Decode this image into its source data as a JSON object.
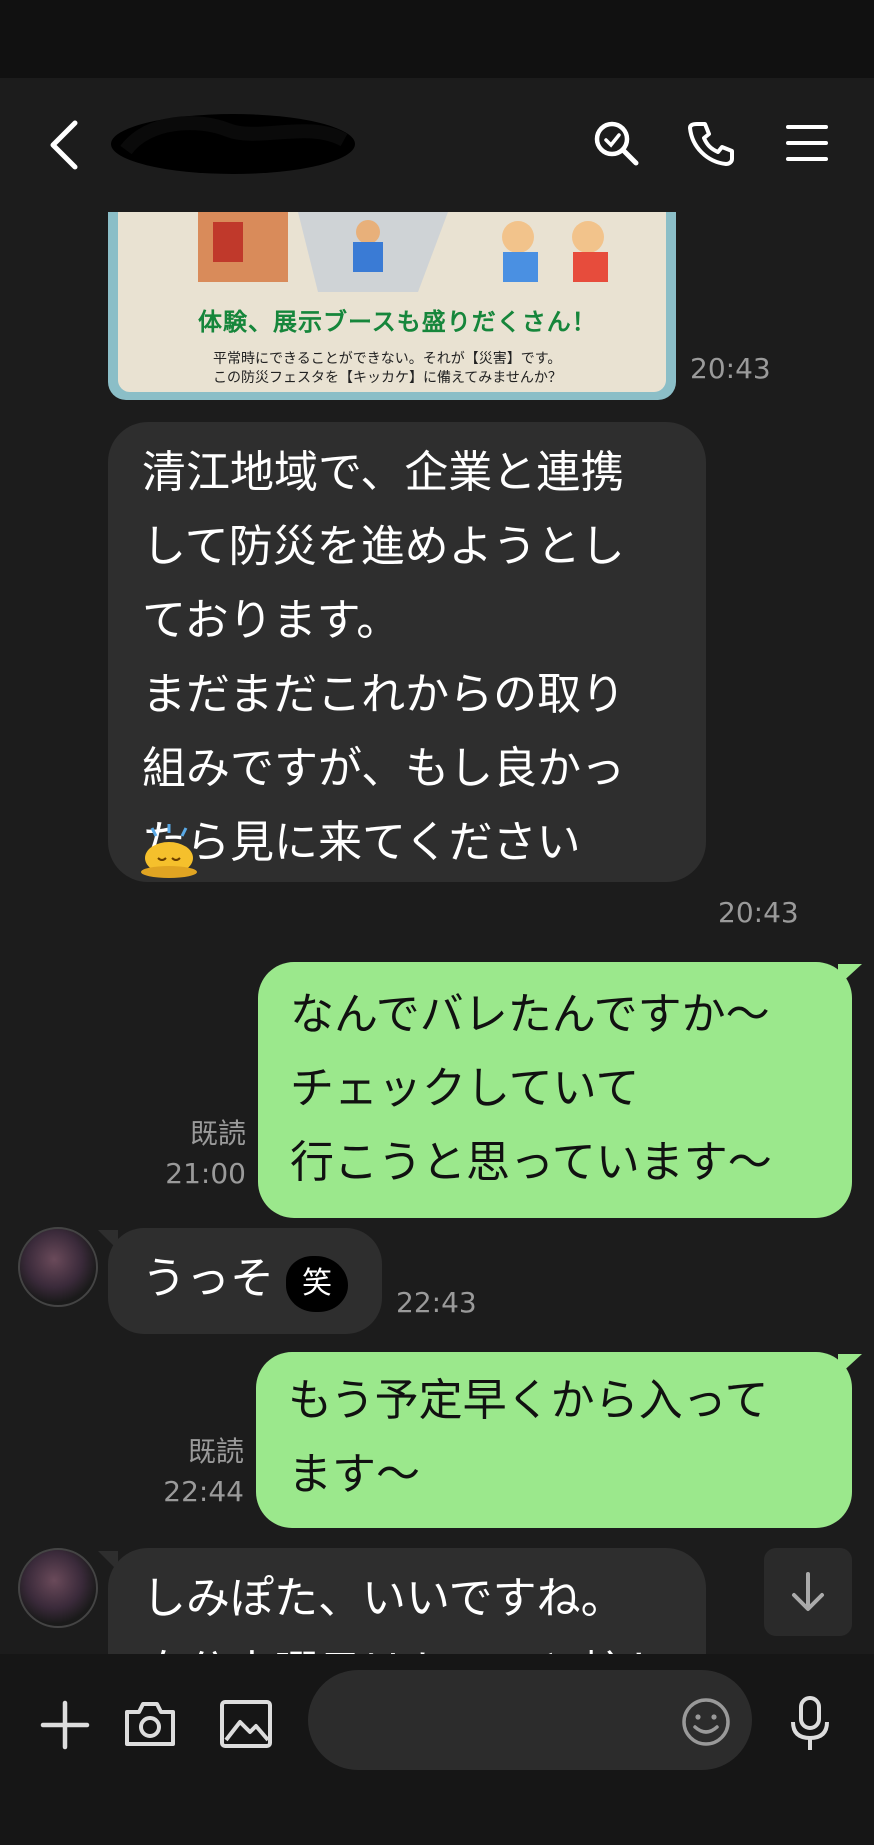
{
  "header": {
    "back_icon": "chevron-left-icon",
    "name_redacted": true,
    "icons": [
      "search-icon",
      "phone-icon",
      "menu-icon"
    ]
  },
  "messages": {
    "image": {
      "text_line1": "体験、展示ブースも盛りだくさん！",
      "text_line2": "平常時にできることができない。それが【災害】です。",
      "text_line3": "この防災フェスタを【キッカケ】に備えてみませんか？",
      "time": "20:43"
    },
    "m1": {
      "lines": [
        "清江地域で、企業と連携",
        "して防災を進めようとし",
        "ております。",
        "まだまだこれからの取り",
        "組みですが、もし良かっ",
        "たら見に来てください"
      ],
      "emoji": "bowing-emoji",
      "time": "20:43"
    },
    "m2": {
      "lines": [
        "なんでバレたんですか〜",
        "チェックしていて",
        "行こうと思っています〜"
      ],
      "read": "既読",
      "time": "21:00"
    },
    "m3": {
      "text": "うっそ",
      "sticker": "笑",
      "time": "22:43"
    },
    "m4": {
      "lines": [
        "もう予定早くから入って",
        "ます〜"
      ],
      "read": "既読",
      "time": "22:44"
    },
    "m5": {
      "line1": "しみぽた、いいですね。",
      "line2": "自分土曜日はちょっと忙しいけど"
    }
  },
  "bottom": {
    "icons": [
      "plus-icon",
      "camera-icon",
      "image-icon",
      "emoji-icon",
      "mic-icon"
    ],
    "input_placeholder": ""
  }
}
